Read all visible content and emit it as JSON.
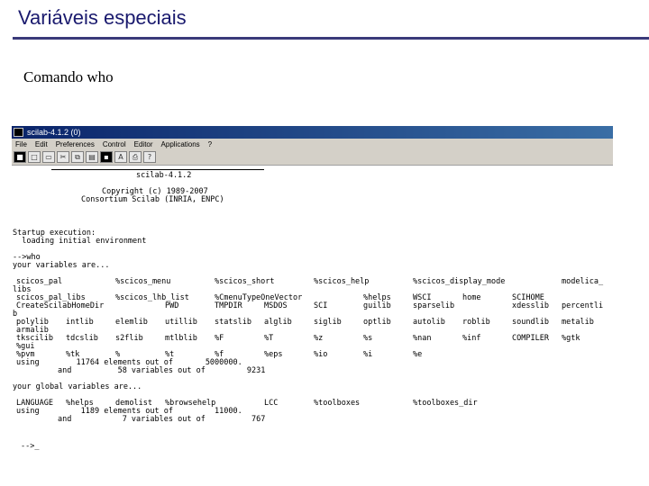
{
  "slide": {
    "title": "Variáveis especiais",
    "subtitle": "Comando who"
  },
  "window": {
    "title": "scilab-4.1.2 (0)",
    "menus": [
      "File",
      "Edit",
      "Preferences",
      "Control",
      "Editor",
      "Applications",
      "?"
    ],
    "toolbar_icons": [
      "scilab-logo-icon",
      "new-file-icon",
      "open-file-icon",
      "cut-icon",
      "copy-icon",
      "paste-icon",
      "scinotes-icon",
      "font-icon",
      "print-icon",
      "help-icon"
    ]
  },
  "console": {
    "banner": {
      "version": "scilab-4.1.2",
      "copyright": "Copyright (c) 1989-2007",
      "consortium": "Consortium Scilab (INRIA, ENPC)"
    },
    "startup": [
      "Startup execution:",
      "  loading initial environment"
    ],
    "command": "-->who",
    "variables_header": "your variables are...",
    "variables_rows": [
      [
        "scicos_pal",
        "%scicos_menu",
        "%scicos_short",
        "%scicos_help",
        "%scicos_display_mode",
        "modelica_"
      ],
      [
        "libs",
        "",
        "",
        "",
        "",
        ""
      ],
      [
        "scicos_pal_libs",
        "%scicos_lhb_list",
        "%CmenuTypeOneVector",
        "%helps",
        "WSCI",
        "home",
        "SCIHOME"
      ],
      [
        "CreateScilabHomeDir",
        "PWD",
        "TMPDIR",
        "MSDOS",
        "SCI",
        "guilib",
        "sparselib",
        "xdesslib",
        "percentli"
      ],
      [
        "b",
        "",
        "",
        "",
        "",
        ""
      ],
      [
        "polylib",
        "intlib",
        "elemlib",
        "utillib",
        "statslib",
        "alglib",
        "siglib",
        "optlib",
        "autolib",
        "roblib",
        "soundlib",
        "metalib"
      ],
      [
        "armalib",
        "",
        "",
        "",
        "",
        ""
      ],
      [
        "tkscilib",
        "tdcslib",
        "s2flib",
        "mtlblib",
        "%F",
        "%T",
        "%z",
        "%s",
        "%nan",
        "%inf",
        "COMPILER",
        "%gtk"
      ],
      [
        "%gui",
        "",
        "",
        "",
        "",
        ""
      ],
      [
        "%pvm",
        "%tk",
        "%",
        "%t",
        "%f",
        "%eps",
        "%io",
        "%i",
        "%e"
      ]
    ],
    "variables_summary": [
      "using        11764 elements out of       5000000.",
      "         and          58 variables out of         9231"
    ],
    "globals_header": "your global variables are...",
    "globals_row": [
      "LANGUAGE",
      "%helps",
      "demolist",
      "%browsehelp",
      "LCC",
      "%toolboxes",
      "%toolboxes_dir"
    ],
    "globals_summary": [
      "using         1189 elements out of         11000.",
      "         and           7 variables out of          767"
    ],
    "prompt": "-->_"
  }
}
